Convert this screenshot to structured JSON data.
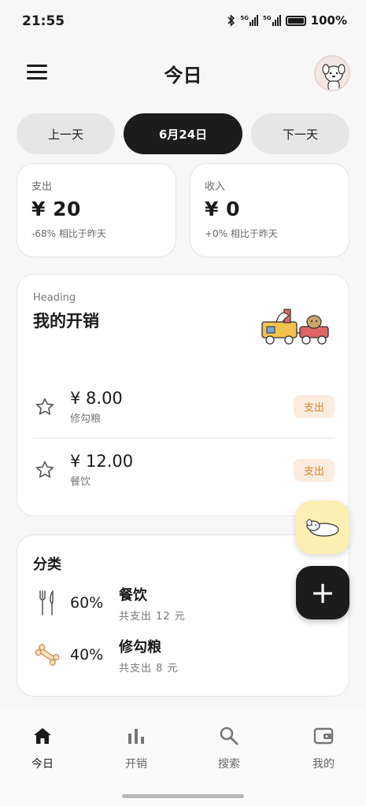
{
  "status_bar": {
    "time": "21:55",
    "network_1": "5G",
    "network_2": "5G",
    "battery": "100%"
  },
  "header": {
    "title": "今日",
    "menu_icon": "hamburger-icon",
    "avatar_icon": "dog-avatar"
  },
  "day_switch": {
    "prev_label": "上一天",
    "current_label": "6月24日",
    "next_label": "下一天"
  },
  "summary": {
    "expense": {
      "label": "支出",
      "amount": "¥ 20",
      "compare": "-68% 相比于昨天"
    },
    "income": {
      "label": "收入",
      "amount": "¥ 0",
      "compare": "+0% 相比于昨天"
    }
  },
  "spending": {
    "heading_small": "Heading",
    "heading": "我的开销",
    "items": [
      {
        "amount": "¥ 8.00",
        "note": "修勾粮",
        "tag": "支出",
        "star_icon": "star-outline-icon"
      },
      {
        "amount": "¥ 12.00",
        "note": "餐饮",
        "tag": "支出",
        "star_icon": "star-outline-icon"
      }
    ]
  },
  "categories": {
    "title": "分类",
    "items": [
      {
        "icon": "fork-knife-icon",
        "percent": "60%",
        "name": "餐饮",
        "sub": "共支出 12 元"
      },
      {
        "icon": "bone-icon",
        "percent": "40%",
        "name": "修勾粮",
        "sub": "共支出 8 元"
      }
    ]
  },
  "fab": {
    "add_label": "+"
  },
  "bottom_nav": {
    "items": [
      {
        "label": "今日",
        "icon": "home-icon",
        "active": true
      },
      {
        "label": "开销",
        "icon": "bar-chart-icon",
        "active": false
      },
      {
        "label": "搜索",
        "icon": "search-icon",
        "active": false
      },
      {
        "label": "我的",
        "icon": "wallet-icon",
        "active": false
      }
    ]
  },
  "colors": {
    "background": "#f7f7f7",
    "dark": "#1c1c1c",
    "tag_bg": "#fbece0",
    "tag_text": "#e0852b",
    "pet_fab": "#fbefb4"
  }
}
